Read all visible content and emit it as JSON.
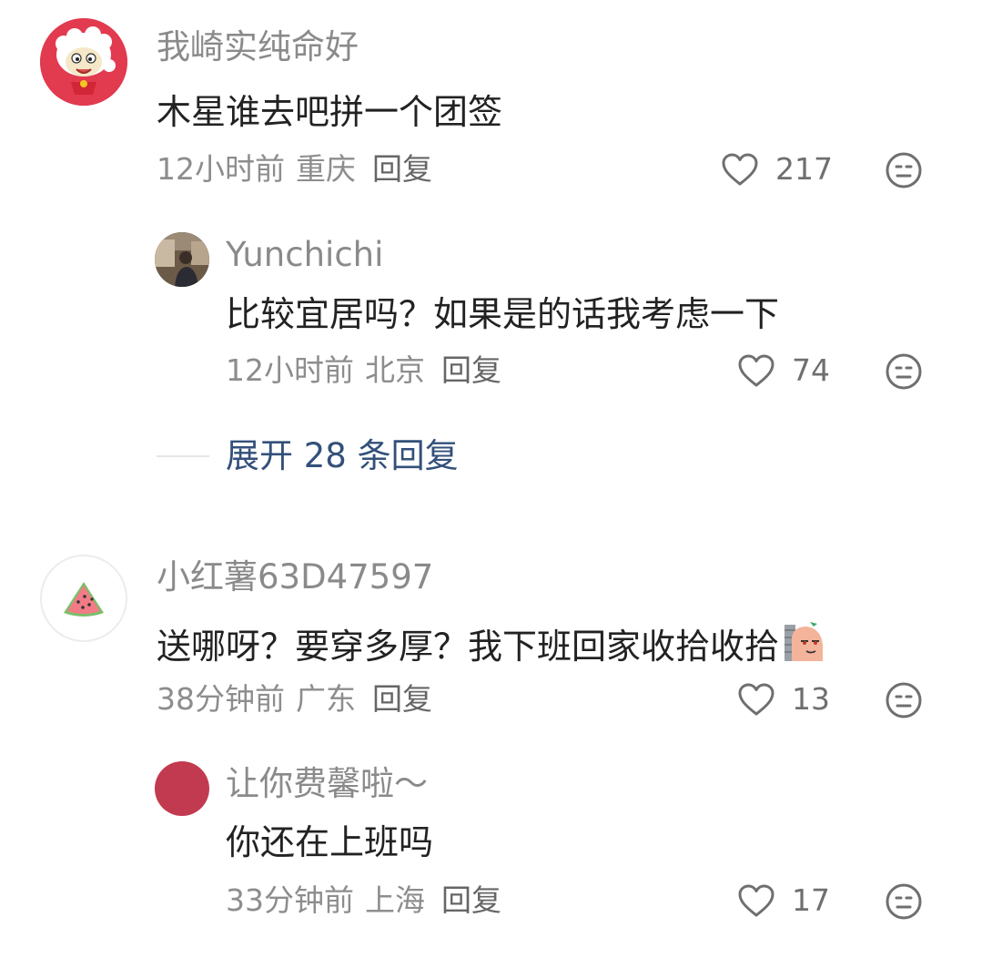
{
  "comments": [
    {
      "author": "我崎实纯命好",
      "text": "木星谁去吧拼一个团签",
      "time": "12小时前",
      "location": "重庆",
      "reply_label": "回复",
      "likes": "217",
      "avatar_icon": "cartoon-sheep-icon",
      "replies": [
        {
          "author": "Yunchichi",
          "text": "比较宜居吗？如果是的话我考虑一下",
          "time": "12小时前",
          "location": "北京",
          "reply_label": "回复",
          "likes": "74",
          "avatar_icon": "person-photo-icon"
        }
      ],
      "expand_label": "展开 28 条回复"
    },
    {
      "author": "小红薯63D47597",
      "text": "送哪呀？要穿多厚？我下班回家收拾收拾",
      "time": "38分钟前",
      "location": "广东",
      "reply_label": "回复",
      "likes": "13",
      "avatar_icon": "watermelon-icon",
      "trailing_sticker": "peeking-sticker-icon",
      "replies": [
        {
          "author": "让你费馨啦～",
          "text": "你还在上班吗",
          "time": "33分钟前",
          "location": "上海",
          "reply_label": "回复",
          "likes": "17",
          "avatar_icon": "red-circle-avatar"
        }
      ]
    }
  ],
  "colors": {
    "link_blue": "#33507a",
    "meta_gray": "#8d8d8d",
    "name_gray": "#8a8a8a",
    "text_dark": "#222222"
  }
}
